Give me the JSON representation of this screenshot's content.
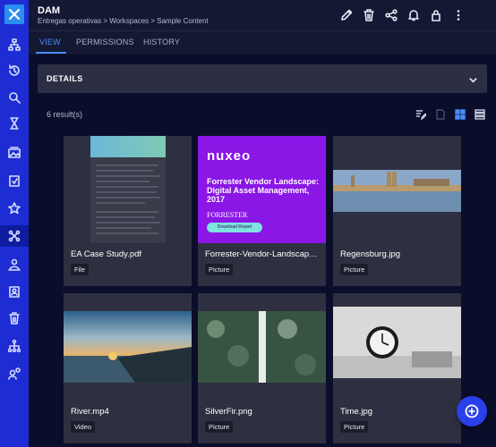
{
  "header": {
    "title": "DAM",
    "breadcrumb": "Entregas operativas > Workspaces > Sample Content"
  },
  "tabs": [
    {
      "label": "VIEW",
      "active": true
    },
    {
      "label": "PERMISSIONS",
      "active": false
    },
    {
      "label": "HISTORY",
      "active": false
    }
  ],
  "details": {
    "label": "DETAILS"
  },
  "results": {
    "text": "6 result(s)"
  },
  "cards": [
    {
      "name": "EA Case Study.pdf",
      "type": "File"
    },
    {
      "name": "Forrester-Vendor-Landscape...",
      "type": "Picture"
    },
    {
      "name": "Regensburg.jpg",
      "type": "Picture"
    },
    {
      "name": "River.mp4",
      "type": "Video"
    },
    {
      "name": "SilverFir.png",
      "type": "Picture"
    },
    {
      "name": "Time.jpg",
      "type": "Picture"
    }
  ],
  "nuxeo_thumb": {
    "brand": "nuxeo",
    "headline": "Forrester Vendor Landscape: Digital Asset Management, 2017",
    "publisher": "FORRESTER",
    "button": "Download Report"
  },
  "colors": {
    "rail": "#1d2dd3",
    "accent": "#4a8dff",
    "fab": "#2a40e8"
  }
}
